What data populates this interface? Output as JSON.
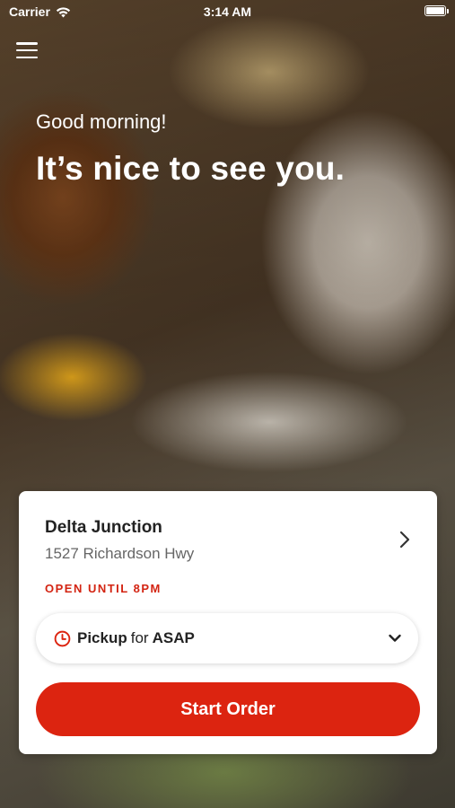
{
  "status_bar": {
    "carrier": "Carrier",
    "time": "3:14 AM"
  },
  "hero": {
    "greeting": "Good morning!",
    "headline": "It’s nice to see you."
  },
  "store": {
    "name": "Delta Junction",
    "address": "1527 Richardson Hwy",
    "hours": "OPEN UNTIL 8PM"
  },
  "order_mode": {
    "mode": "Pickup",
    "connector": "for",
    "time": "ASAP"
  },
  "actions": {
    "start_order": "Start Order"
  },
  "colors": {
    "accent": "#dc2410",
    "hours_text": "#d32412"
  },
  "icons": [
    "wifi-icon",
    "battery-icon",
    "menu-icon",
    "chevron-right-icon",
    "clock-icon",
    "chevron-down-icon"
  ]
}
